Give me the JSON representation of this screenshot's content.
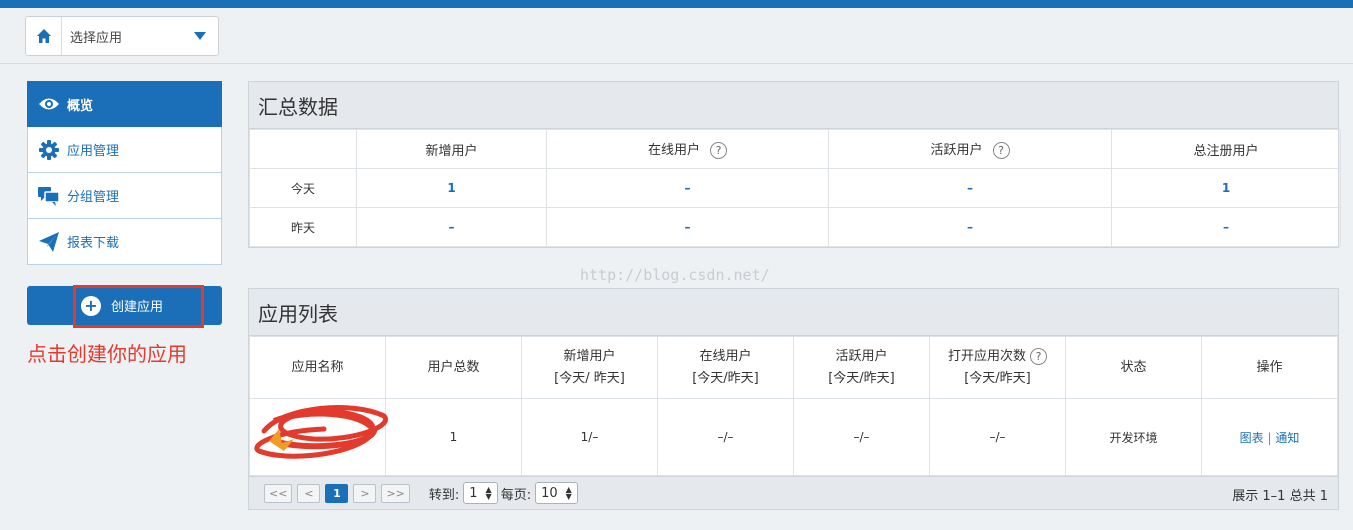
{
  "header": {
    "app_select": {
      "label": "选择应用"
    }
  },
  "sidebar": {
    "items": [
      {
        "label": "概览",
        "icon": "eye-icon"
      },
      {
        "label": "应用管理",
        "icon": "gear-icon"
      },
      {
        "label": "分组管理",
        "icon": "chat-icon"
      },
      {
        "label": "报表下载",
        "icon": "paper-plane-icon"
      }
    ],
    "create_button": "创建应用",
    "annotation": "点击创建你的应用"
  },
  "summary": {
    "title": "汇总数据",
    "columns": [
      "",
      "新增用户",
      "在线用户",
      "活跃用户",
      "总注册用户"
    ],
    "help_mark": "?",
    "rows": [
      {
        "label": "今天",
        "values": [
          "1",
          "–",
          "–",
          "1"
        ]
      },
      {
        "label": "昨天",
        "values": [
          "–",
          "–",
          "–",
          "–"
        ]
      }
    ]
  },
  "watermark": "http://blog.csdn.net/",
  "app_list": {
    "title": "应用列表",
    "columns": [
      "应用名称",
      "用户总数",
      "新增用户",
      "[今天/ 昨天]",
      "在线用户",
      "[今天/昨天]",
      "活跃用户",
      "[今天/昨天]",
      "打开应用次数",
      "[今天/昨天]",
      "状态",
      "操作"
    ],
    "rows": [
      {
        "name": "",
        "total": "1",
        "new": "1/–",
        "online": "–/–",
        "active": "–/–",
        "opens": "–/–",
        "status": "开发环境",
        "op_chart": "图表",
        "op_sep": "|",
        "op_notify": "通知"
      }
    ],
    "pagination": {
      "first": "<<",
      "prev": "<",
      "current": "1",
      "next": ">",
      "last": ">>",
      "goto_label": "转到:",
      "goto_value": "1",
      "per_page_label": "每页:",
      "per_page_value": "10",
      "summary": "展示 1–1 总共 1"
    }
  },
  "colors": {
    "primary": "#1a6fb8",
    "annotation_red": "#e23b2e"
  }
}
